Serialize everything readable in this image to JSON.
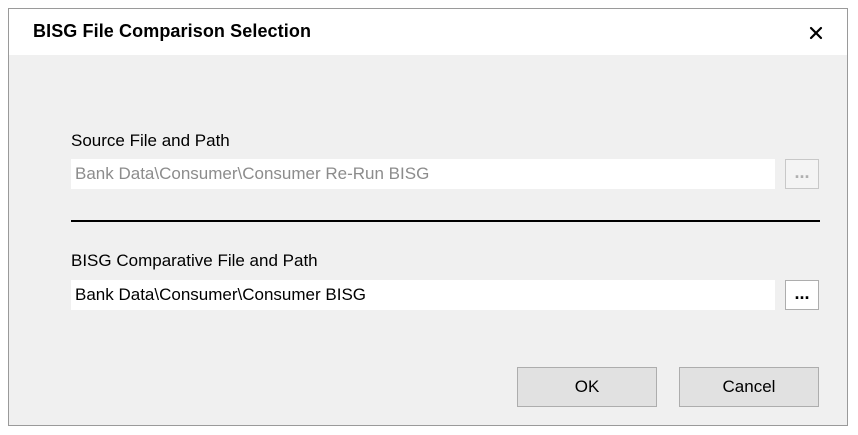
{
  "dialog": {
    "title": "BISG File Comparison Selection",
    "close_icon": "close-icon"
  },
  "source": {
    "label": "Source File and Path",
    "value": "Bank Data\\Consumer\\Consumer Re-Run BISG",
    "browse_label": "...",
    "enabled": false
  },
  "comparative": {
    "label": "BISG Comparative File and Path",
    "value": "Bank Data\\Consumer\\Consumer BISG",
    "browse_label": "...",
    "enabled": true
  },
  "buttons": {
    "ok_label": "OK",
    "cancel_label": "Cancel"
  },
  "colors": {
    "dialog_background": "#f0f0f0",
    "title_background": "#ffffff",
    "disabled_text": "#8c8c8c",
    "button_face": "#e1e1e1"
  }
}
